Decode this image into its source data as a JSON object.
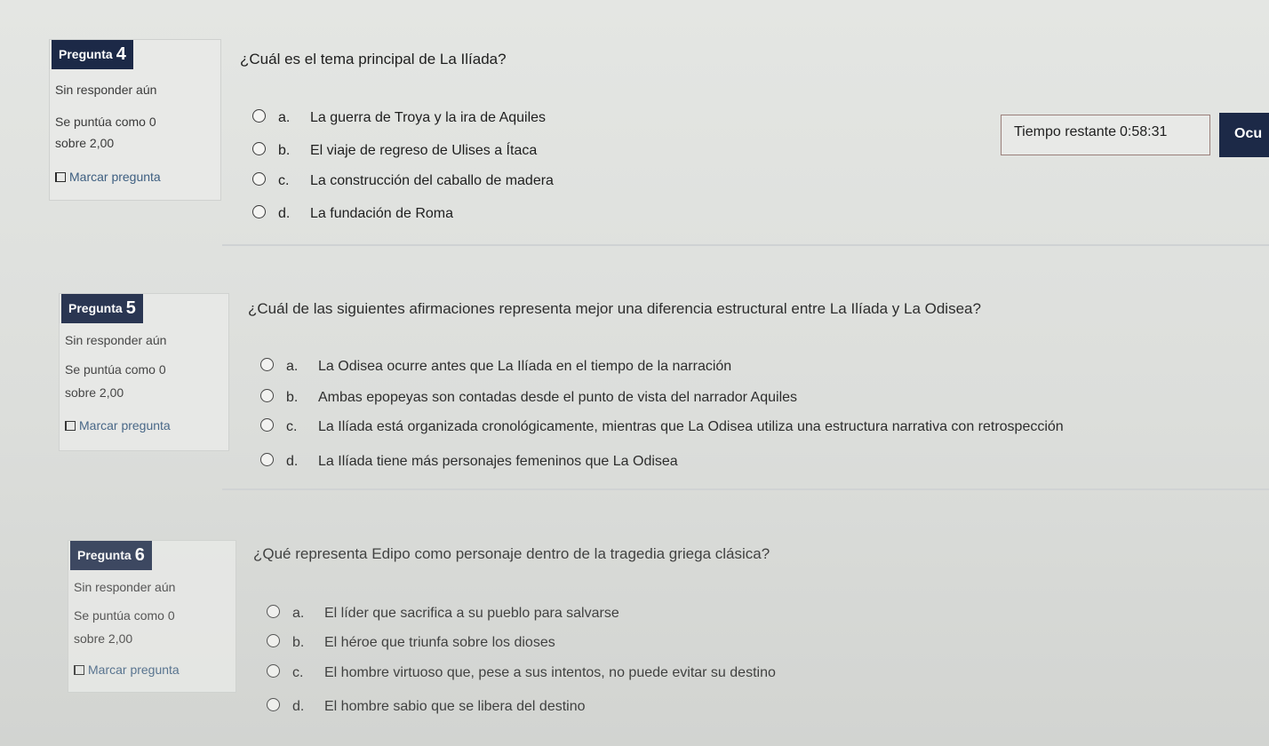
{
  "timer": {
    "label": "Tiempo restante",
    "value": "0:58:31",
    "hide_button_label": "Ocu"
  },
  "questions": [
    {
      "label": "Pregunta",
      "number": "4",
      "status": "Sin responder aún",
      "score_line1": "Se puntúa como 0",
      "score_line2": "sobre 2,00",
      "flag_label": "Marcar pregunta",
      "text": "¿Cuál es el tema principal de La Ilíada?",
      "answers": [
        {
          "letter": "a.",
          "text": "La guerra de Troya y la ira de Aquiles"
        },
        {
          "letter": "b.",
          "text": "El viaje de regreso de Ulises a Ítaca"
        },
        {
          "letter": "c.",
          "text": "La construcción del caballo de madera"
        },
        {
          "letter": "d.",
          "text": "La fundación de Roma"
        }
      ]
    },
    {
      "label": "Pregunta",
      "number": "5",
      "status": "Sin responder aún",
      "score_line1": "Se puntúa como 0",
      "score_line2": "sobre 2,00",
      "flag_label": "Marcar pregunta",
      "text": "¿Cuál de las siguientes afirmaciones representa mejor una diferencia estructural entre La Ilíada y La Odisea?",
      "answers": [
        {
          "letter": "a.",
          "text": "La Odisea ocurre antes que La Ilíada en el tiempo de la narración"
        },
        {
          "letter": "b.",
          "text": "Ambas epopeyas son contadas desde el punto de vista del narrador Aquiles"
        },
        {
          "letter": "c.",
          "text": "La Ilíada está organizada cronológicamente, mientras que La Odisea utiliza una estructura narrativa con retrospección"
        },
        {
          "letter": "d.",
          "text": "La Ilíada tiene más personajes femeninos que La Odisea"
        }
      ]
    },
    {
      "label": "Pregunta",
      "number": "6",
      "status": "Sin responder aún",
      "score_line1": "Se puntúa como 0",
      "score_line2": "sobre 2,00",
      "flag_label": "Marcar pregunta",
      "text": "¿Qué representa Edipo como personaje dentro de la tragedia griega clásica?",
      "answers": [
        {
          "letter": "a.",
          "text": "El líder que sacrifica a su pueblo para salvarse"
        },
        {
          "letter": "b.",
          "text": "El héroe que triunfa sobre los dioses"
        },
        {
          "letter": "c.",
          "text": "El hombre virtuoso que, pese a sus intentos, no puede evitar su destino"
        },
        {
          "letter": "d.",
          "text": "El hombre sabio que se libera del destino"
        }
      ]
    }
  ]
}
